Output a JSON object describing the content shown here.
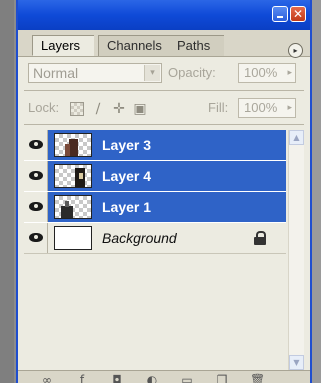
{
  "window": {
    "minimize_glyph": "",
    "close_glyph": "✕"
  },
  "tabs": [
    {
      "label": "Layers"
    },
    {
      "label": "Channels"
    },
    {
      "label": "Paths"
    }
  ],
  "options": {
    "blend_mode": "Normal",
    "opacity_label": "Opacity:",
    "opacity_value": "100%",
    "lock_label": "Lock:",
    "fill_label": "Fill:",
    "fill_value": "100%"
  },
  "layers": [
    {
      "name": "Layer 3",
      "selected": true
    },
    {
      "name": "Layer 4",
      "selected": true
    },
    {
      "name": "Layer 1",
      "selected": true
    },
    {
      "name": "Background",
      "selected": false
    }
  ],
  "icons": {
    "menu": "▸",
    "dropdown": "▾",
    "field_arrow": "▸",
    "scroll_up": "▲",
    "scroll_down": "▼",
    "lock_brush": "∕",
    "lock_move": "✛",
    "lock_all": "▣",
    "bottom": [
      "∞",
      "ƒ",
      "◘",
      "◐",
      "▭",
      "❐",
      "🗑"
    ]
  },
  "colors": {
    "selection": "#2f63c7",
    "titlebar": "#0f4ad8"
  }
}
